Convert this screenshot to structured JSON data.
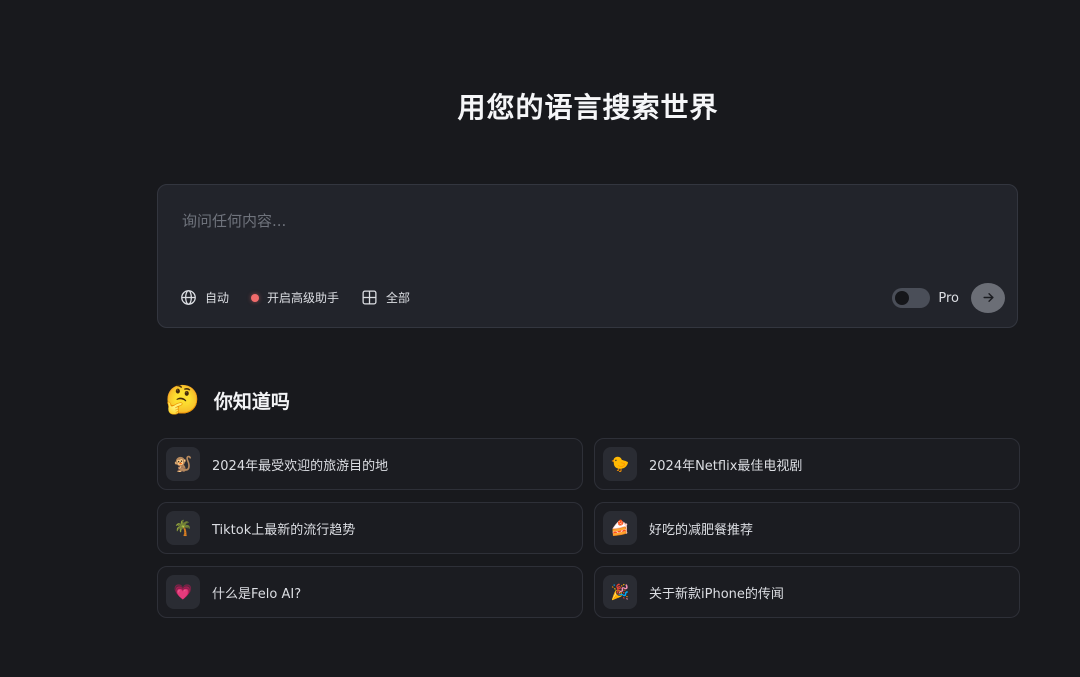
{
  "headline": "用您的语言搜索世界",
  "search": {
    "placeholder": "询问任何内容...",
    "value": "",
    "tools": [
      {
        "icon": "globe-icon",
        "label": "自动"
      },
      {
        "icon": "red-dot-icon",
        "label": "开启高级助手"
      },
      {
        "icon": "grid-icon",
        "label": "全部"
      }
    ],
    "pro_label": "Pro",
    "pro_enabled": false
  },
  "did_you_know": {
    "emoji": "🤔",
    "title": "你知道吗",
    "cards": [
      {
        "emoji": "🐒",
        "label": "2024年最受欢迎的旅游目的地"
      },
      {
        "emoji": "🐤",
        "label": "2024年Netflix最佳电视剧"
      },
      {
        "emoji": "🌴",
        "label": "Tiktok上最新的流行趋势"
      },
      {
        "emoji": "🍰",
        "label": "好吃的减肥餐推荐"
      },
      {
        "emoji": "💗",
        "label": "什么是Felo AI?"
      },
      {
        "emoji": "🎉",
        "label": "关于新款iPhone的传闻"
      }
    ]
  },
  "colors": {
    "background": "#18191d",
    "panel": "#22242b",
    "accent_dot": "#f06b6b"
  }
}
